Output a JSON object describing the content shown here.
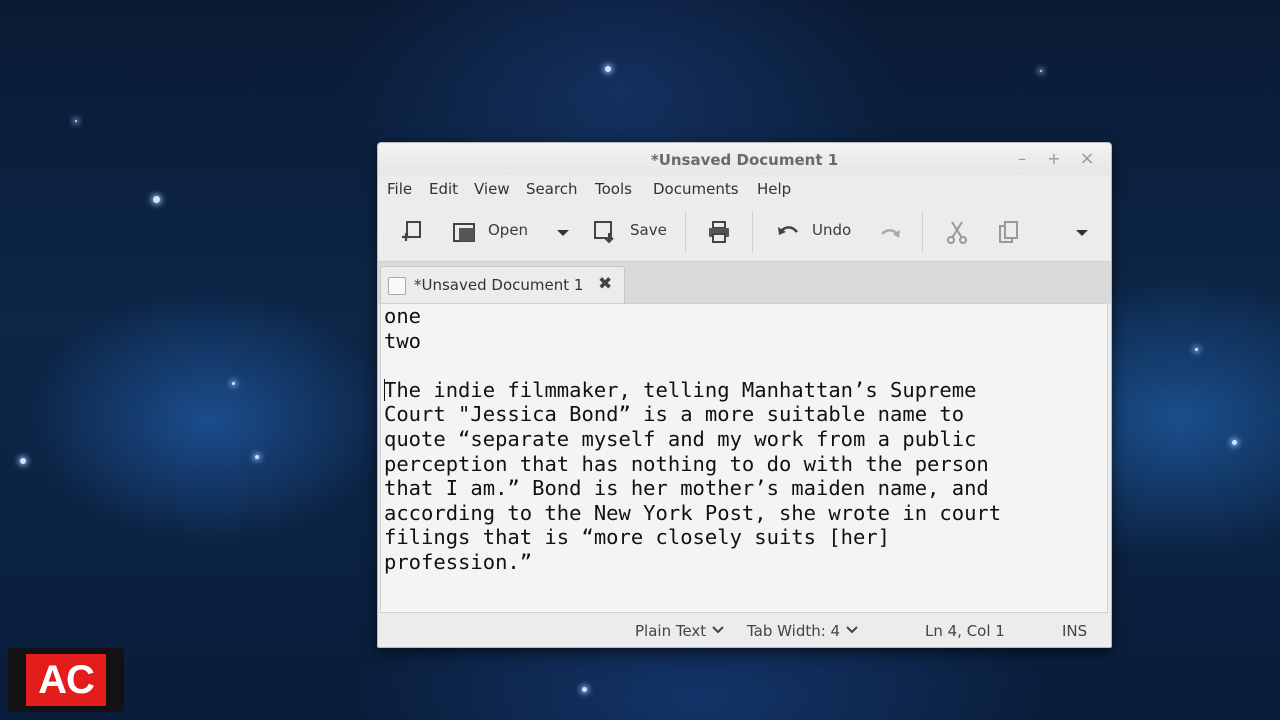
{
  "window": {
    "title": "*Unsaved Document 1",
    "controls": {
      "minimize": "–",
      "maximize": "+",
      "close": "×"
    }
  },
  "menu": {
    "items": [
      {
        "label": "File"
      },
      {
        "label": "Edit"
      },
      {
        "label": "View"
      },
      {
        "label": "Search"
      },
      {
        "label": "Tools"
      },
      {
        "label": "Documents"
      },
      {
        "label": "Help"
      }
    ]
  },
  "toolbar": {
    "new_icon": "new-document-icon",
    "open_label": "Open",
    "save_label": "Save",
    "print_icon": "printer-icon",
    "undo_label": "Undo",
    "redo_icon": "redo-icon",
    "cut_icon": "scissors-icon",
    "copy_icon": "copy-icon",
    "overflow_icon": "chevron-down-icon"
  },
  "tab": {
    "label": "*Unsaved Document 1",
    "close": "✖"
  },
  "editor": {
    "lines": [
      "one",
      "two",
      "",
      "The indie filmmaker, telling Manhattan’s Supreme",
      "Court \"Jessica Bond” is a more suitable name to",
      "quote “separate myself and my work from a public",
      "perception that has nothing to do with the person",
      "that I am.” Bond is her mother’s maiden name, and",
      "according to the New York Post, she wrote in court",
      "filings that is “more closely suits [her]",
      "profession.”"
    ]
  },
  "status": {
    "language": "Plain Text",
    "tab_width": "Tab Width:  4",
    "position": "Ln 4, Col 1",
    "mode": "INS"
  },
  "logo": {
    "text": "AC"
  }
}
